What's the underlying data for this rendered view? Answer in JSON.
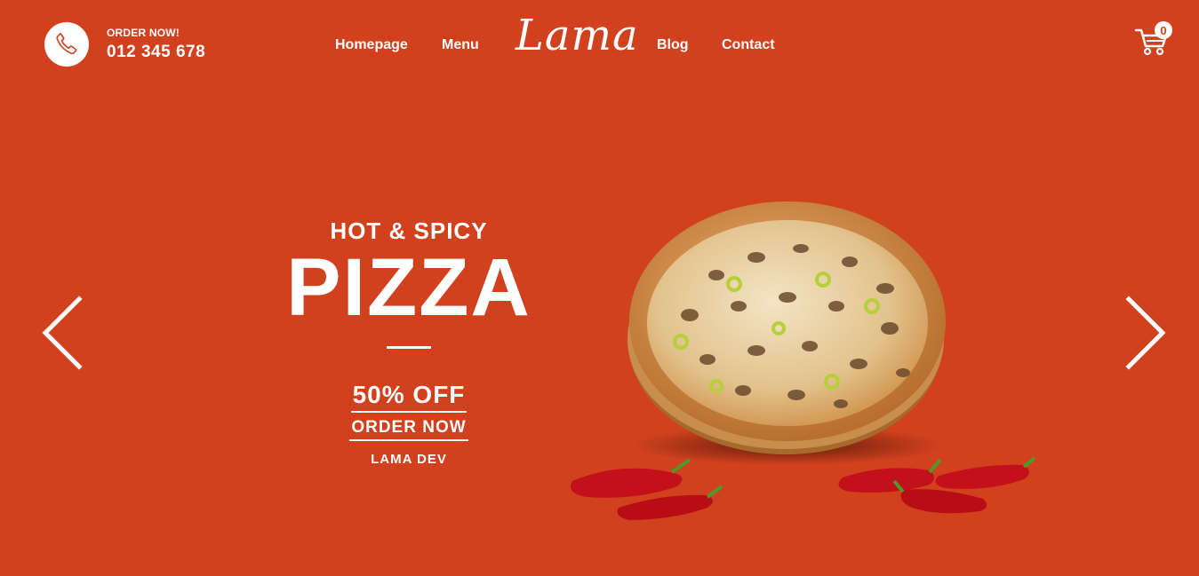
{
  "header": {
    "order_label": "ORDER NOW!",
    "phone": "012 345 678",
    "nav": {
      "homepage": "Homepage",
      "menu": "Menu",
      "logo": "Lama",
      "blog": "Blog",
      "contact": "Contact"
    },
    "cart_count": "0"
  },
  "slide": {
    "subtitle": "HOT & SPICY",
    "title": "PIZZA",
    "offer": "50% OFF",
    "cta": "ORDER NOW",
    "author": "LAMA DEV"
  },
  "icons": {
    "phone": "telephone-icon",
    "cart": "shopping-cart-icon",
    "prev": "chevron-left-icon",
    "next": "chevron-right-icon"
  },
  "colors": {
    "background": "#d1411e",
    "foreground": "#ffffff"
  }
}
